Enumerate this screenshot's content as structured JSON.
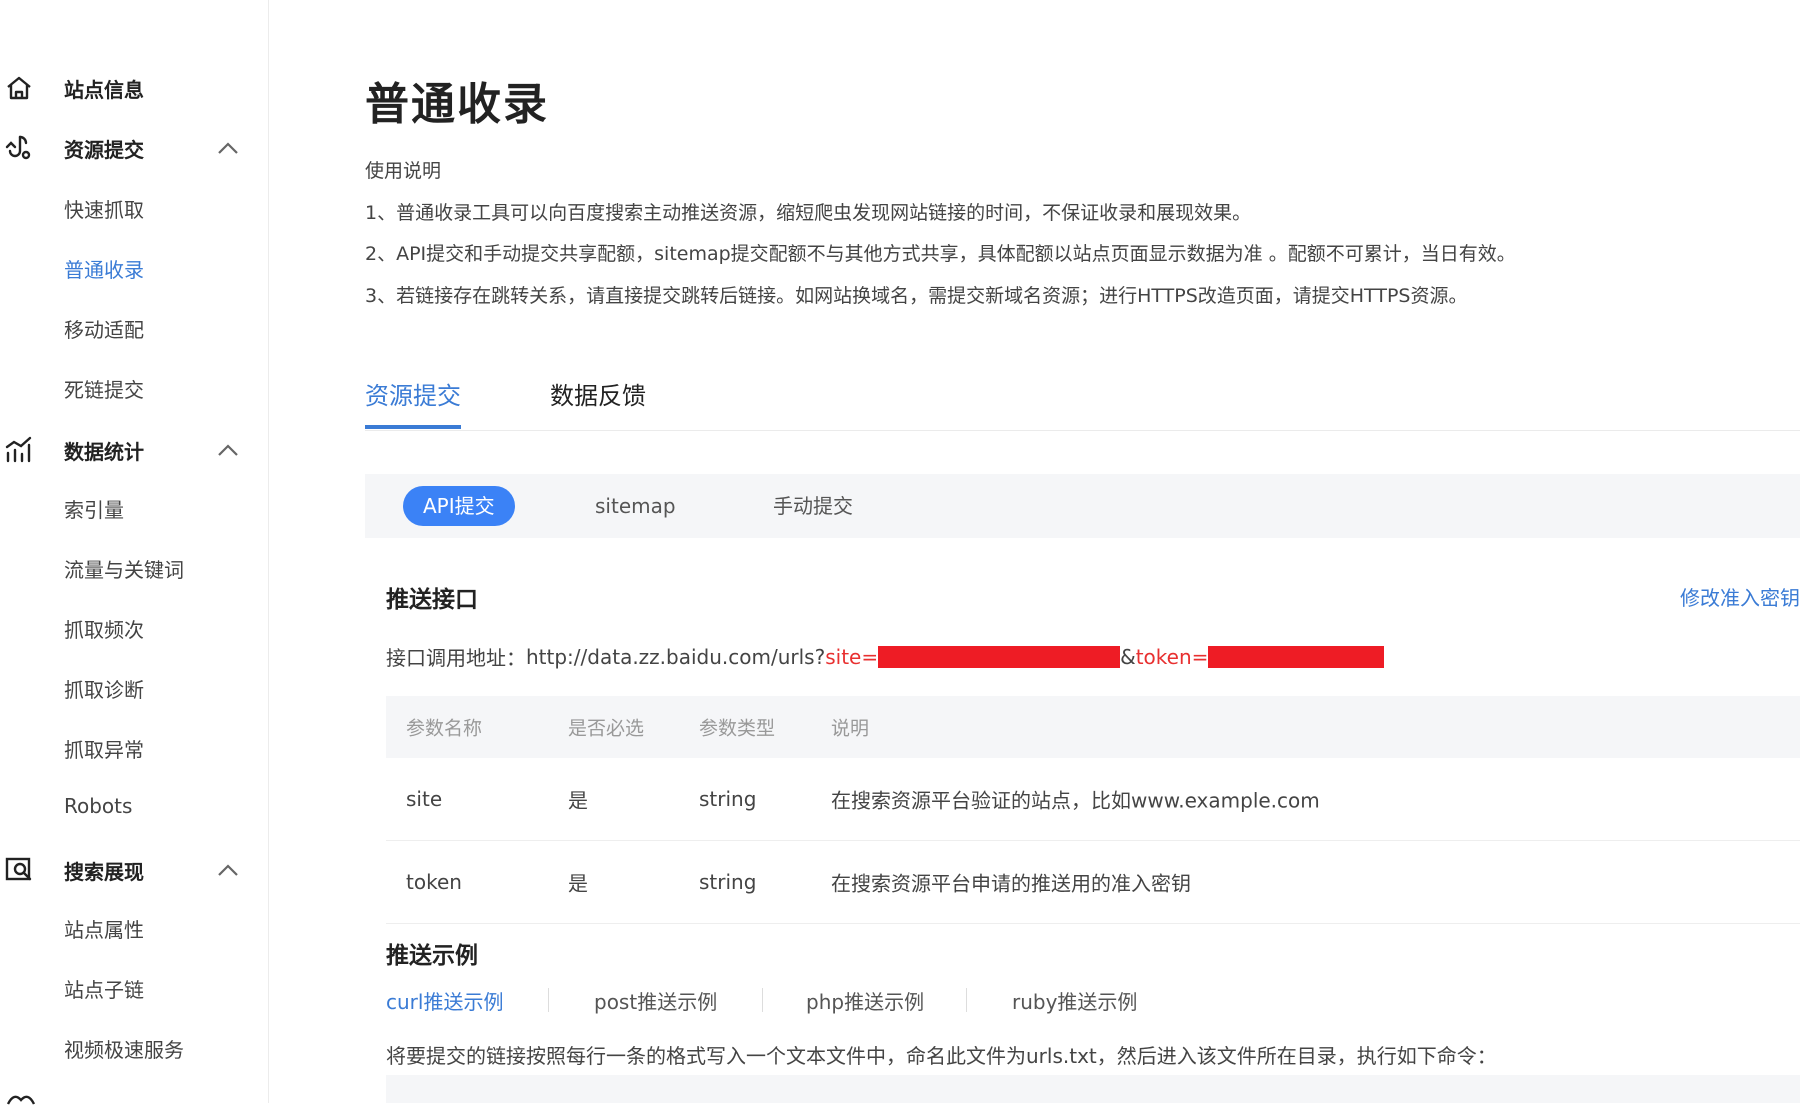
{
  "sidebar": {
    "groups": [
      {
        "label": "站点信息",
        "icon": "home-icon",
        "expandable": false
      },
      {
        "label": "资源提交",
        "icon": "resource-submit-icon",
        "expandable": true,
        "items": [
          "快速抓取",
          "普通收录",
          "移动适配",
          "死链提交"
        ]
      },
      {
        "label": "数据统计",
        "icon": "stats-chart-icon",
        "expandable": true,
        "items": [
          "索引量",
          "流量与关键词",
          "抓取频次",
          "抓取诊断",
          "抓取异常",
          "Robots"
        ]
      },
      {
        "label": "搜索展现",
        "icon": "search-display-icon",
        "expandable": true,
        "items": [
          "站点属性",
          "站点子链",
          "视频极速服务"
        ]
      }
    ],
    "active_item": "普通收录"
  },
  "main": {
    "title": "普通收录",
    "usage": {
      "heading": "使用说明",
      "lines": [
        "1、普通收录工具可以向百度搜索主动推送资源，缩短爬虫发现网站链接的时间，不保证收录和展现效果。",
        "2、API提交和手动提交共享配额，sitemap提交配额不与其他方式共享，具体配额以站点页面显示数据为准 。配额不可累计，当日有效。",
        "3、若链接存在跳转关系，请直接提交跳转后链接。如网站换域名，需提交新域名资源；进行HTTPS改造页面，请提交HTTPS资源。"
      ]
    },
    "tabs": [
      {
        "label": "资源提交",
        "active": true
      },
      {
        "label": "数据反馈",
        "active": false
      }
    ],
    "subtabs": [
      {
        "label": "API提交",
        "active": true
      },
      {
        "label": "sitemap",
        "active": false
      },
      {
        "label": "手动提交",
        "active": false
      }
    ],
    "push_api": {
      "title": "推送接口",
      "modify_link": "修改准入密钥",
      "endpoint_label": "接口调用地址：",
      "endpoint_url": "http://data.zz.baidu.com/urls?",
      "site_param": "site=",
      "token_amp": "&",
      "token_param": "token=",
      "table": {
        "headers": [
          "参数名称",
          "是否必选",
          "参数类型",
          "说明"
        ],
        "rows": [
          [
            "site",
            "是",
            "string",
            "在搜索资源平台验证的站点，比如www.example.com"
          ],
          [
            "token",
            "是",
            "string",
            "在搜索资源平台申请的推送用的准入密钥"
          ]
        ]
      }
    },
    "push_example": {
      "title": "推送示例",
      "links": [
        {
          "label": "curl推送示例",
          "active": true
        },
        {
          "label": "post推送示例",
          "active": false
        },
        {
          "label": "php推送示例",
          "active": false
        },
        {
          "label": "ruby推送示例",
          "active": false
        }
      ],
      "description": "将要提交的链接按照每行一条的格式写入一个文本文件中，命名此文件为urls.txt，然后进入该文件所在目录，执行如下命令："
    }
  },
  "colors": {
    "accent": "#3a7bd5",
    "pill_active": "#3b82f6",
    "redaction": "#ee1c25",
    "param_red": "#e83030"
  }
}
